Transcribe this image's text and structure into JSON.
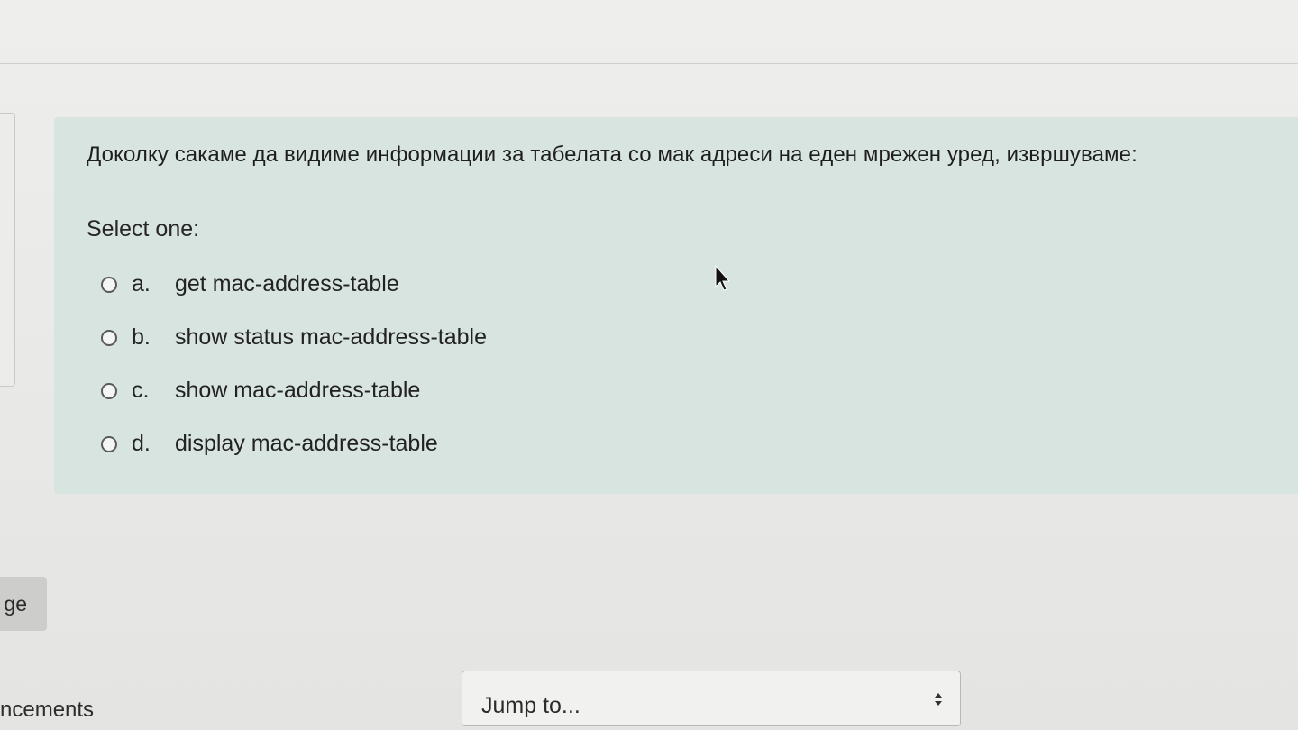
{
  "question": {
    "text": "Доколку сакаме да видиме информации за табелата со мак адреси на еден мрежен уред, извршуваме:",
    "select_prompt": "Select one:",
    "answers": [
      {
        "letter": "a.",
        "text": "get mac-address-table"
      },
      {
        "letter": "b.",
        "text": "show status mac-address-table"
      },
      {
        "letter": "c.",
        "text": "show mac-address-table"
      },
      {
        "letter": "d.",
        "text": "display mac-address-table"
      }
    ]
  },
  "footer": {
    "page_button_label": "ge",
    "announcements_label": "ncements",
    "jump_select_value": "Jump to..."
  },
  "colors": {
    "question_background": "#d8e4df",
    "page_background": "#e9e9e7"
  }
}
